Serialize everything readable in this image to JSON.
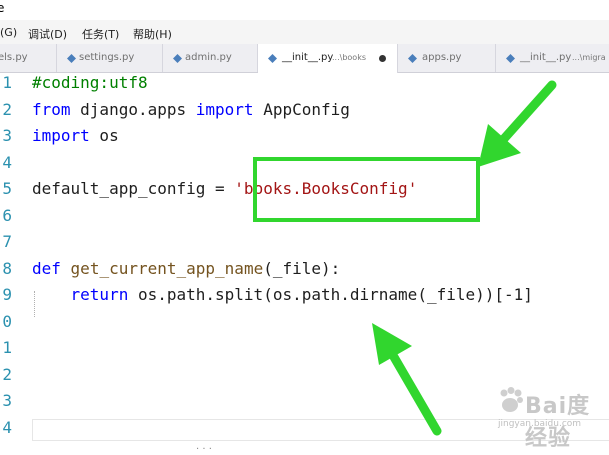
{
  "titlebar": {
    "char": "e"
  },
  "menu": {
    "items": [
      "(G)",
      "调试(D)",
      "任务(T)",
      "帮助(H)"
    ]
  },
  "tabs": [
    {
      "label": "els.py",
      "path": "",
      "active": false
    },
    {
      "label": "settings.py",
      "path": "",
      "active": false
    },
    {
      "label": "admin.py",
      "path": "",
      "active": false
    },
    {
      "label": "__init__.py",
      "path": "...\\books",
      "active": true,
      "dirty": true
    },
    {
      "label": "apps.py",
      "path": "",
      "active": false
    },
    {
      "label": "__init__.py",
      "path": "...\\migra",
      "active": false
    }
  ],
  "editor": {
    "line_numbers": [
      "1",
      "2",
      "3",
      "4",
      "5",
      "6",
      "7",
      "8",
      "9",
      "0",
      "1",
      "2",
      "3",
      "4"
    ],
    "lines": [
      {
        "n": 1,
        "parts": [
          [
            "cm",
            "#coding:utf8"
          ]
        ]
      },
      {
        "n": 2,
        "parts": [
          [
            "kw",
            "from"
          ],
          [
            "",
            " django.apps "
          ],
          [
            "kw",
            "import"
          ],
          [
            "",
            " AppConfig"
          ]
        ]
      },
      {
        "n": 3,
        "parts": [
          [
            "kw",
            "import"
          ],
          [
            "",
            " os"
          ]
        ]
      },
      {
        "n": 4,
        "parts": []
      },
      {
        "n": 5,
        "parts": [
          [
            "",
            "default_app_config = "
          ],
          [
            "str",
            "'books.BooksConfig'"
          ]
        ]
      },
      {
        "n": 6,
        "parts": []
      },
      {
        "n": 7,
        "parts": []
      },
      {
        "n": 8,
        "parts": [
          [
            "kw",
            "def"
          ],
          [
            "",
            " "
          ],
          [
            "fn",
            "get_current_app_name"
          ],
          [
            "",
            "(_file):"
          ]
        ]
      },
      {
        "n": 9,
        "parts": [
          [
            "",
            "    "
          ],
          [
            "kw",
            "return"
          ],
          [
            "",
            " os.path.split(os.path.dirname(_file))[-1]"
          ]
        ]
      }
    ]
  },
  "annotation": {
    "color": "#31d62e"
  },
  "watermark": {
    "text": "Bai度经验",
    "sub": "jingyan.baidu.com"
  },
  "bottom_fragment": "· · ·"
}
